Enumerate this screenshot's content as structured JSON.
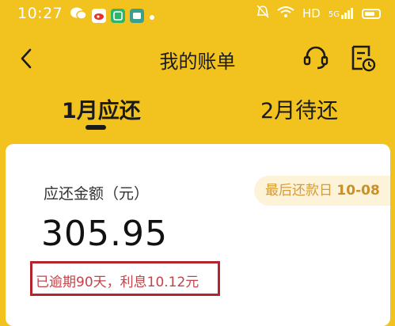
{
  "status_bar": {
    "time": "10:27",
    "network": "HD",
    "signal": "5G"
  },
  "header": {
    "title": "我的账单",
    "back_icon": "chevron-left-icon",
    "support_icon": "headset-icon",
    "bill_icon": "bill-clock-icon"
  },
  "tabs": [
    {
      "label": "1月应还",
      "active": true
    },
    {
      "label": "2月待还",
      "active": false
    }
  ],
  "bill": {
    "amount_label": "应还金额（元）",
    "due_prefix": "最后还款日",
    "due_date": "10-08",
    "amount": "305.95",
    "overdue_note": "已逾期90天，利息10.12元"
  },
  "colors": {
    "brand_yellow": "#f2c21f",
    "text_dark": "#1a1a1a",
    "due_chip_bg": "#fdf3d8",
    "due_chip_text": "#d59b3a",
    "overdue_text": "#c0444a",
    "highlight_box": "#b2262b"
  }
}
